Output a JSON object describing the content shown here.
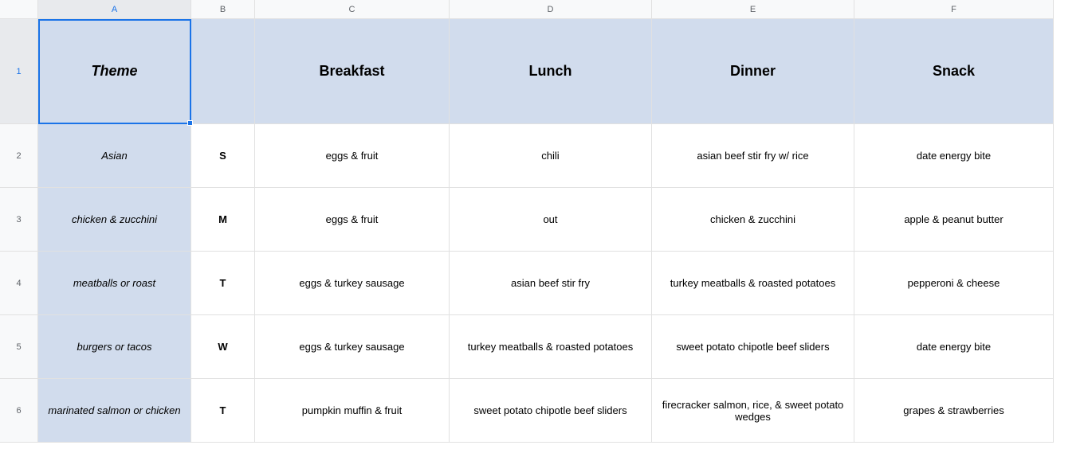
{
  "columns": [
    "A",
    "B",
    "C",
    "D",
    "E",
    "F"
  ],
  "rowNums": [
    "1",
    "2",
    "3",
    "4",
    "5",
    "6"
  ],
  "header": {
    "theme": "Theme",
    "b": "",
    "breakfast": "Breakfast",
    "lunch": "Lunch",
    "dinner": "Dinner",
    "snack": "Snack"
  },
  "rows": [
    {
      "theme": "Asian",
      "day": "S",
      "breakfast": "eggs & fruit",
      "lunch": "chili",
      "dinner": "asian beef stir fry w/ rice",
      "snack": "date energy bite"
    },
    {
      "theme": "chicken & zucchini",
      "day": "M",
      "breakfast": "eggs & fruit",
      "lunch": "out",
      "dinner": "chicken & zucchini",
      "snack": "apple & peanut butter"
    },
    {
      "theme": "meatballs or roast",
      "day": "T",
      "breakfast": "eggs & turkey sausage",
      "lunch": "asian beef stir fry",
      "dinner": "turkey meatballs & roasted potatoes",
      "snack": "pepperoni & cheese"
    },
    {
      "theme": "burgers or tacos",
      "day": "W",
      "breakfast": "eggs & turkey sausage",
      "lunch": "turkey meatballs & roasted potatoes",
      "dinner": "sweet potato chipotle beef sliders",
      "snack": "date energy bite"
    },
    {
      "theme": "marinated salmon or chicken",
      "day": "T",
      "breakfast": "pumpkin muffin & fruit",
      "lunch": "sweet potato chipotle beef sliders",
      "dinner": "firecracker salmon, rice, & sweet potato wedges",
      "snack": "grapes & strawberries"
    }
  ]
}
